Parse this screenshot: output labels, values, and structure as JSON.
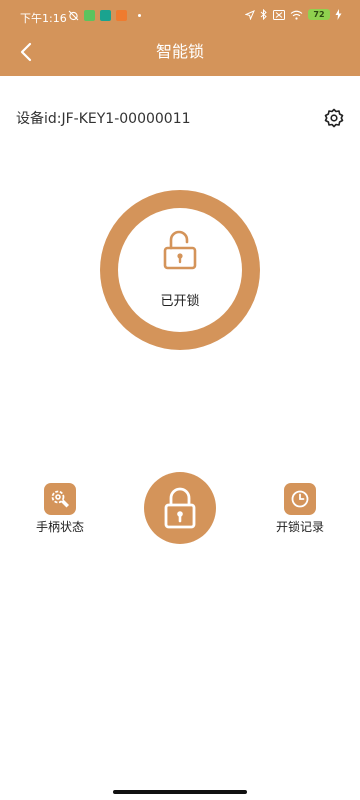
{
  "status_bar": {
    "time": "下午1:16",
    "battery": "72"
  },
  "header": {
    "title": "智能锁"
  },
  "device": {
    "id_text": "设备id:JF-KEY1-00000011"
  },
  "lock_status": {
    "label": "已开锁"
  },
  "actions": {
    "handle_status_label": "手柄状态",
    "unlock_records_label": "开锁记录"
  },
  "colors": {
    "accent": "#d4945a",
    "background": "#ffffff"
  },
  "icons": {
    "back": "chevron-left-icon",
    "settings": "gear-icon",
    "status": "unlocked-padlock-icon",
    "handle": "gear-pipe-icon",
    "records": "clock-icon",
    "main_action": "locked-padlock-icon"
  }
}
